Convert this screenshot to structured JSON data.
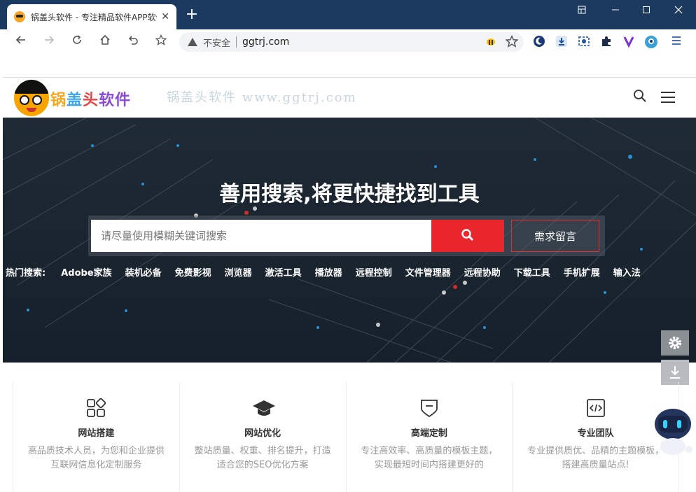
{
  "browser": {
    "tab_title": "锅盖头软件 - 专注精品软件APP软件",
    "tab_close": "✕",
    "new_tab": "+",
    "insecure_label": "不安全",
    "url": "ggtrj.com"
  },
  "site": {
    "logo_chars": [
      "锅",
      "盖",
      "头",
      "软件"
    ],
    "watermark": "锅盖头软件 www.ggtrj.com"
  },
  "hero": {
    "title": "善用搜索,将更快捷找到工具",
    "search_placeholder": "请尽量使用模糊关键词搜索",
    "message_button": "需求留言",
    "hot_label": "热门搜索:",
    "hot_items": [
      "Adobe家族",
      "装机必备",
      "免费影视",
      "浏览器",
      "激活工具",
      "播放器",
      "远程控制",
      "文件管理器",
      "远程协助",
      "下载工具",
      "手机扩展",
      "输入法"
    ]
  },
  "features": [
    {
      "title": "网站搭建",
      "desc": "高品质技术人员，为您和企业提供互联网信息化定制服务"
    },
    {
      "title": "网站优化",
      "desc": "整站质量、权重、排名提升，打造适合您的SEO优化方案"
    },
    {
      "title": "高端定制",
      "desc": "专注高效率、高质量的模板主题，实现最短时间内搭建更好的"
    },
    {
      "title": "专业团队",
      "desc": "专业提供质优、品精的主题模板，搭建高质量站点!"
    }
  ],
  "colors": {
    "accent": "#e8262b",
    "titlebar": "#1c3a60"
  }
}
